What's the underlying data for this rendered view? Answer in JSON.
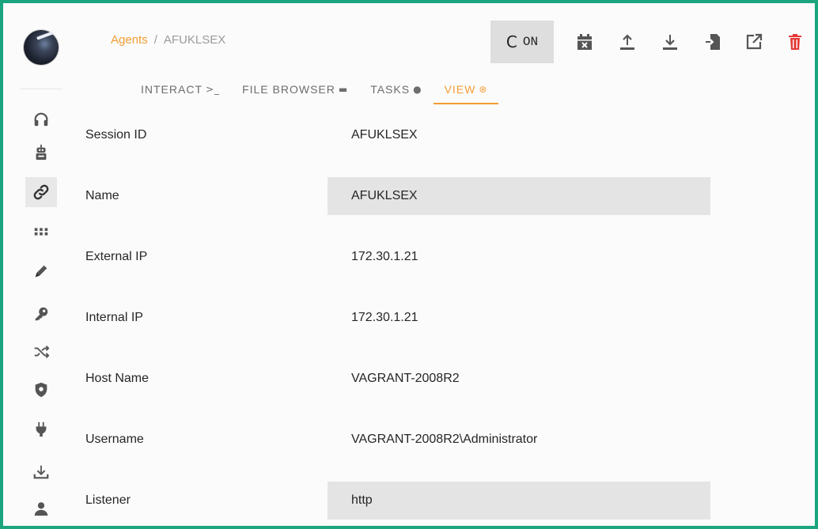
{
  "breadcrumb": {
    "agents": "Agents",
    "separator": "/",
    "current": "AFUKLSEX"
  },
  "toolbar": {
    "on_icon": "C",
    "on_label": "ON",
    "icons": [
      "calendar-remove-icon",
      "upload-icon",
      "download-icon",
      "file-import-icon",
      "open-external-icon",
      "trash-icon"
    ],
    "trash_color": "#e53935"
  },
  "tabs": [
    {
      "label": "INTERACT",
      "icon": ">_"
    },
    {
      "label": "FILE BROWSER",
      "icon": "▬"
    },
    {
      "label": "TASKS",
      "icon": "●"
    },
    {
      "label": "VIEW",
      "icon": "⊛"
    }
  ],
  "accent_color": "#f39c33",
  "border_color": "#1aa57f",
  "sidebar": {
    "icons": [
      "headphones-icon",
      "robot-icon",
      "link-icon",
      "grid-dots-icon",
      "pencil-icon",
      "key-icon",
      "shuffle-icon",
      "shield-icon",
      "plug-icon",
      "download-icon",
      "user-icon"
    ],
    "active": "link-icon"
  },
  "fields": [
    {
      "label": "Session ID",
      "value": "AFUKLSEX"
    },
    {
      "label": "Name",
      "value": "AFUKLSEX"
    },
    {
      "label": "External IP",
      "value": "172.30.1.21"
    },
    {
      "label": "Internal IP",
      "value": "172.30.1.21"
    },
    {
      "label": "Host Name",
      "value": "VAGRANT-2008R2"
    },
    {
      "label": "Username",
      "value": "VAGRANT-2008R2\\Administrator"
    },
    {
      "label": "Listener",
      "value": "http"
    }
  ]
}
